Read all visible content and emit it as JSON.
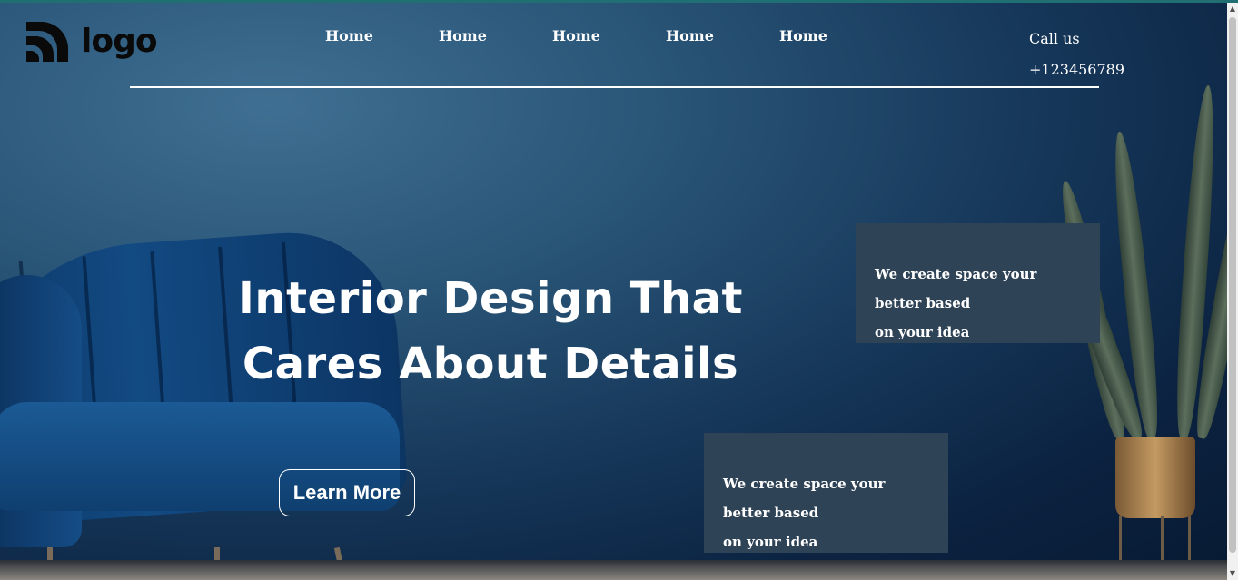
{
  "brand": {
    "logo_text": "logo",
    "logo_icon": "signal-arcs-icon",
    "logo_color": "#0a0a0a"
  },
  "nav": {
    "items": [
      {
        "label": "Home"
      },
      {
        "label": "Home"
      },
      {
        "label": "Home"
      },
      {
        "label": "Home"
      },
      {
        "label": "Home"
      }
    ]
  },
  "contact": {
    "label": "Call us",
    "phone": "+123456789"
  },
  "hero": {
    "headline_line1": "Interior Design That",
    "headline_line2": "Cares About Details",
    "cta_label": "Learn More"
  },
  "cards": [
    {
      "line1": "We create space your better based",
      "line2": "on your idea"
    },
    {
      "line1": "We create space your better based",
      "line2": "on your idea"
    }
  ],
  "colors": {
    "card_bg": "#2f4356",
    "text": "#ffffff",
    "accent_topline": "#1f6f73"
  }
}
